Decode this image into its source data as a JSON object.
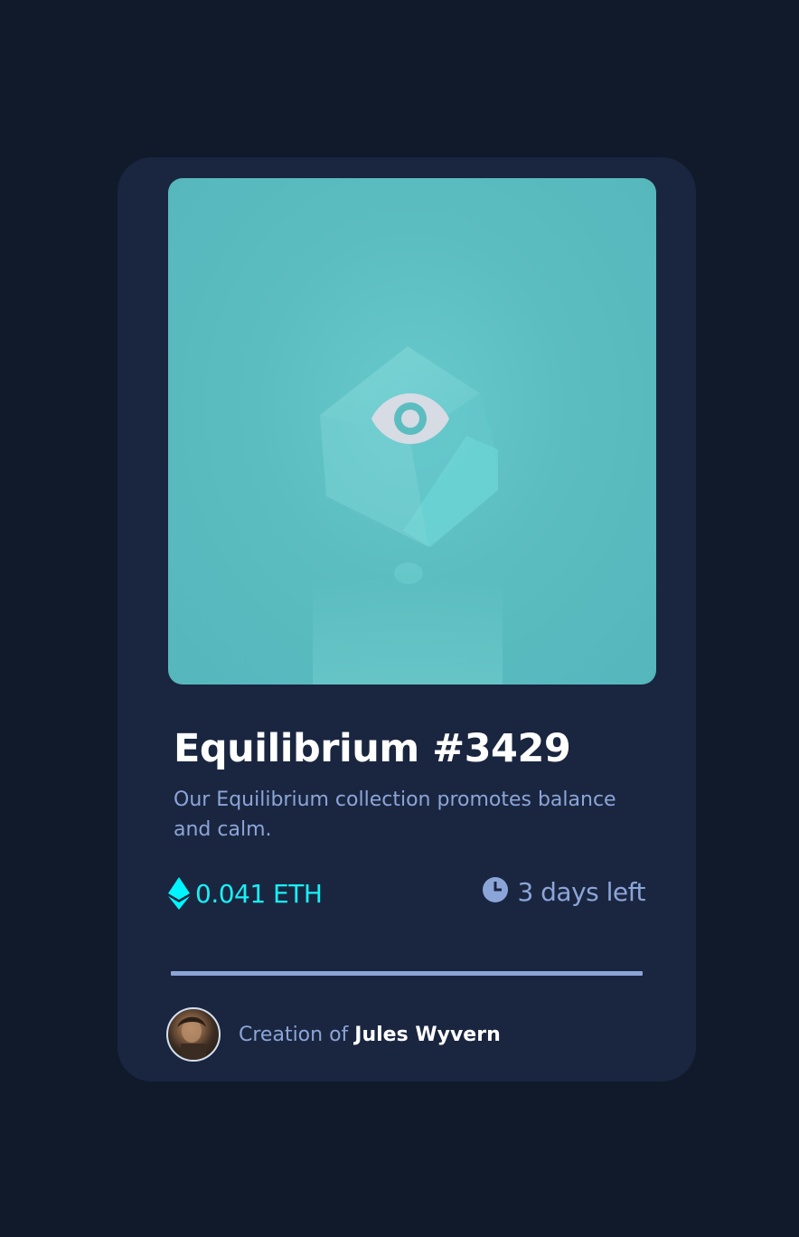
{
  "card": {
    "title": "Equilibrium #3429",
    "description": "Our Equilibrium collection promotes balance and calm.",
    "price": "0.041 ETH",
    "time_left": "3 days left",
    "creator_prefix": "Creation of",
    "creator_name": "Jules Wyvern"
  },
  "icons": {
    "overlay": "eye-icon",
    "price": "ethereum-icon",
    "time": "clock-icon"
  },
  "colors": {
    "page_bg": "#111a2a",
    "card_bg": "#1a2640",
    "accent_cyan": "#00f5ff",
    "soft_blue": "#8ca5d8",
    "white": "#ffffff",
    "image_overlay": "#5cbdc0"
  }
}
